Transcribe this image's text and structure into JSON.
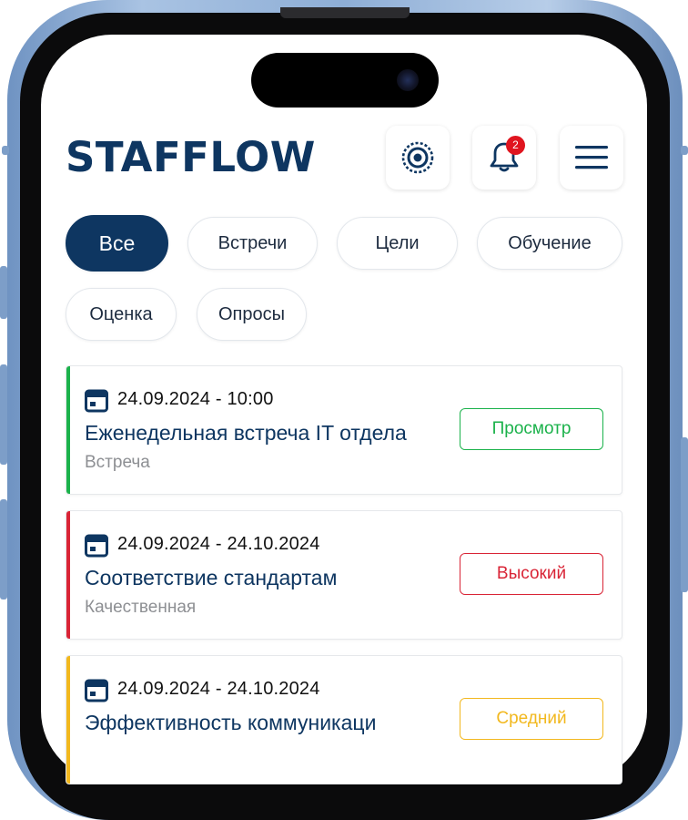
{
  "app": {
    "logo": "STAFFLOW"
  },
  "header": {
    "notifications_count": "2"
  },
  "filters": [
    {
      "label": "Все",
      "active": true
    },
    {
      "label": "Встречи",
      "active": false
    },
    {
      "label": "Цели",
      "active": false
    },
    {
      "label": "Обучение",
      "active": false
    },
    {
      "label": "Оценка",
      "active": false
    },
    {
      "label": "Опросы",
      "active": false
    }
  ],
  "events": [
    {
      "date": "24.09.2024 - 10:00",
      "title": "Еженедельная встреча IT отдела",
      "subtitle": "Встреча",
      "action": "Просмотр",
      "color": "#1bb24b"
    },
    {
      "date": "24.09.2024 - 24.10.2024",
      "title": "Соответствие стандартам",
      "subtitle": "Качественная",
      "action": "Высокий",
      "color": "#d92436"
    },
    {
      "date": "24.09.2024 - 24.10.2024",
      "title": "Эффективность коммуникаци",
      "subtitle": "",
      "action": "Средний",
      "color": "#f2b81e"
    }
  ],
  "colors": {
    "brand": "#0e3661",
    "badge": "#e0151f"
  },
  "icons": {
    "settings": "target-icon",
    "notifications": "bell-icon",
    "menu": "hamburger-icon",
    "calendar": "calendar-icon"
  }
}
